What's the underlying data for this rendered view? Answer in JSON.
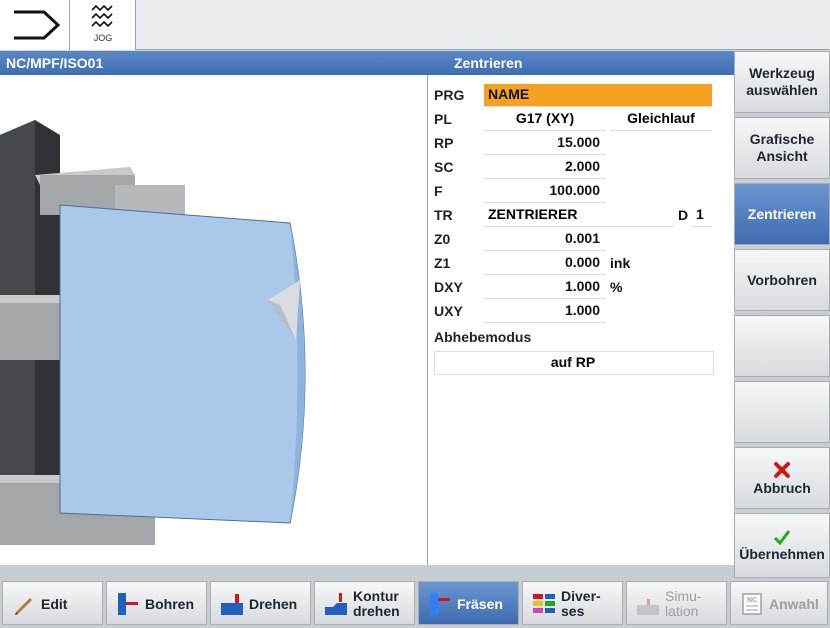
{
  "topbar": {
    "jog_label": "JOG"
  },
  "header": {
    "path": "NC/MPF/ISO01",
    "cycle_title": "Zentrieren"
  },
  "form": {
    "prg": {
      "label": "PRG",
      "value": "NAME"
    },
    "pl": {
      "label": "PL",
      "value": "G17 (XY)",
      "mode": "Gleichlauf"
    },
    "rp": {
      "label": "RP",
      "value": "15.000"
    },
    "sc": {
      "label": "SC",
      "value": "2.000"
    },
    "f": {
      "label": "F",
      "value": "100.000"
    },
    "tr": {
      "label": "TR",
      "value": "ZENTRIERER",
      "d_label": "D",
      "d_value": "1"
    },
    "z0": {
      "label": "Z0",
      "value": "0.001"
    },
    "z1": {
      "label": "Z1",
      "value": "0.000",
      "unit": "ink"
    },
    "dxy": {
      "label": "DXY",
      "value": "1.000",
      "unit": "%"
    },
    "uxy": {
      "label": "UXY",
      "value": "1.000"
    },
    "abhebemodus": {
      "label": "Abhebemodus",
      "value": "auf RP"
    }
  },
  "right_softkeys": {
    "werkzeug_line1": "Werkzeug",
    "werkzeug_line2": "auswählen",
    "grafische_line1": "Grafische",
    "grafische_line2": "Ansicht",
    "zentrieren": "Zentrieren",
    "vorbohren": "Vorbohren",
    "abbruch": "Abbruch",
    "uebernehmen": "Übernehmen"
  },
  "bottom_softkeys": {
    "edit": "Edit",
    "bohren": "Bohren",
    "drehen": "Drehen",
    "kontur_line1": "Kontur",
    "kontur_line2": "drehen",
    "fraesen": "Fräsen",
    "divers_line1": "Diver-",
    "divers_line2": "ses",
    "simu_line1": "Simu-",
    "simu_line2": "lation",
    "anwahl": "Anwahl"
  },
  "colors": {
    "header_blue": "#3e6db3",
    "active_key": "#3d6bb0",
    "prg_highlight": "#f5a020",
    "workpiece": "#a9c8ea",
    "chuck": "#3a3c40",
    "cancel_red": "#d01818",
    "accept_green": "#22a822"
  }
}
